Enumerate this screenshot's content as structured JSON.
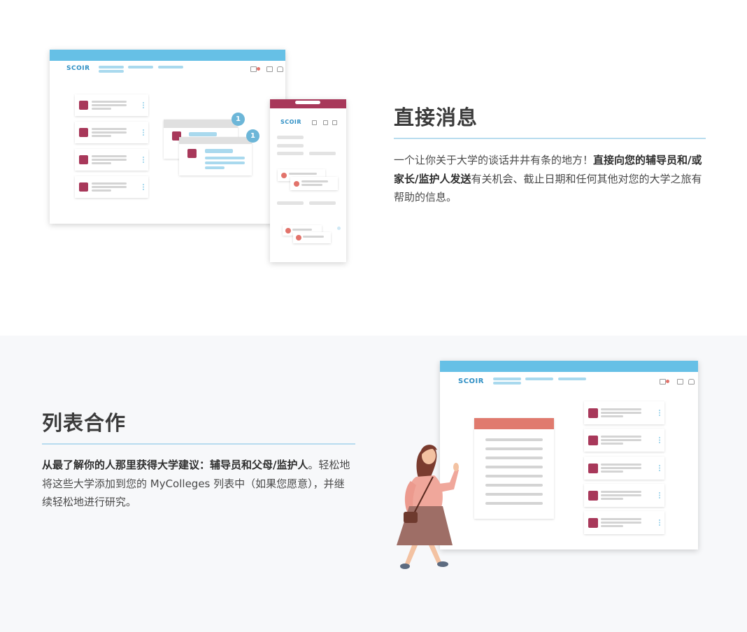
{
  "section1": {
    "title": "直接消息",
    "para_pre": "一个让你关于大学的谈话井井有条的地方！",
    "para_bold": "直接向您的辅导员和/或家长/监护人发送",
    "para_post": "有关机会、截止日期和任何其他对您的大学之旅有帮助的信息。"
  },
  "section2": {
    "title": "列表合作",
    "para_bold": "从最了解你的人那里获得大学建议：辅导员和父母/监护人",
    "para_post": "。轻松地将这些大学添加到您的 MyColleges 列表中（如果您愿意），并继续轻松地进行研究。"
  },
  "mock": {
    "logo": "SCOIR",
    "badge_count_1": "1",
    "badge_count_2": "1"
  },
  "colors": {
    "accent_blue": "#66c0e6",
    "brand_maroon": "#a8385a",
    "coral": "#e2736b",
    "rule": "#b8dcef"
  }
}
